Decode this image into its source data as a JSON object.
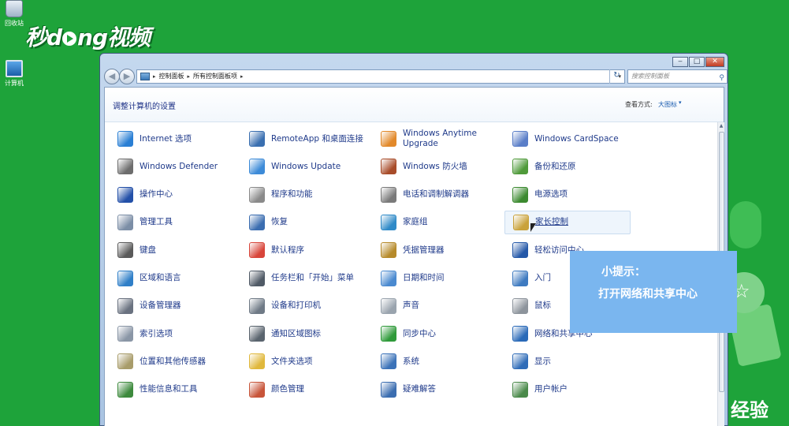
{
  "desktop": {
    "icons": [
      {
        "label": "回收站",
        "icon": "recycle-bin-icon"
      },
      {
        "label": "计算机",
        "icon": "computer-icon"
      }
    ]
  },
  "watermark": {
    "text_left": "秒d",
    "text_right": "ng视频"
  },
  "decoration_text": "经验",
  "window": {
    "controls": {
      "minimize": "‒",
      "maximize": "□",
      "close": "✕"
    },
    "nav": {
      "back": "◀",
      "forward": "▶"
    },
    "address": {
      "crumbs": [
        "控制面板",
        "所有控制面板项"
      ]
    },
    "search": {
      "placeholder": "搜索控制面板"
    },
    "page_title": "调整计算机的设置",
    "view": {
      "label": "查看方式:",
      "value": "大图标"
    },
    "items": [
      [
        {
          "label": "Internet 选项",
          "icon": "globe-icon",
          "color": "#2a7fd4"
        },
        {
          "label": "RemoteApp 和桌面连接",
          "icon": "remote-desktop-icon",
          "color": "#3a6fb0"
        },
        {
          "label": "Windows Anytime Upgrade",
          "icon": "windows-flag-icon",
          "color": "#e2892a"
        },
        {
          "label": "Windows CardSpace",
          "icon": "cardspace-icon",
          "color": "#5a7ec8"
        }
      ],
      [
        {
          "label": "Windows Defender",
          "icon": "defender-icon",
          "color": "#6d6d6d"
        },
        {
          "label": "Windows Update",
          "icon": "update-icon",
          "color": "#3d8bd8"
        },
        {
          "label": "Windows 防火墙",
          "icon": "firewall-icon",
          "color": "#a84c2a"
        },
        {
          "label": "备份和还原",
          "icon": "backup-icon",
          "color": "#4f9a3a"
        }
      ],
      [
        {
          "label": "操作中心",
          "icon": "action-center-flag-icon",
          "color": "#2350a8"
        },
        {
          "label": "程序和功能",
          "icon": "programs-icon",
          "color": "#8a8a8a"
        },
        {
          "label": "电话和调制解调器",
          "icon": "phone-modem-icon",
          "color": "#7a7a7a"
        },
        {
          "label": "电源选项",
          "icon": "power-icon",
          "color": "#3c8a30"
        }
      ],
      [
        {
          "label": "管理工具",
          "icon": "admin-tools-icon",
          "color": "#7c8ea6"
        },
        {
          "label": "恢复",
          "icon": "recovery-icon",
          "color": "#3b6db0"
        },
        {
          "label": "家庭组",
          "icon": "homegroup-icon",
          "color": "#2f8ac8"
        },
        {
          "label": "家长控制",
          "icon": "parental-controls-icon",
          "color": "#c9a23b"
        }
      ],
      [
        {
          "label": "键盘",
          "icon": "keyboard-icon",
          "color": "#5a5a5a"
        },
        {
          "label": "默认程序",
          "icon": "default-programs-icon",
          "color": "#d8453a"
        },
        {
          "label": "凭据管理器",
          "icon": "credential-icon",
          "color": "#b68a2a"
        },
        {
          "label": "轻松访问中心",
          "icon": "ease-of-access-icon",
          "color": "#2458a8"
        }
      ],
      [
        {
          "label": "区域和语言",
          "icon": "region-globe-icon",
          "color": "#2f7fc8"
        },
        {
          "label": "任务栏和「开始」菜单",
          "icon": "taskbar-icon",
          "color": "#505a66"
        },
        {
          "label": "日期和时间",
          "icon": "datetime-icon",
          "color": "#4a8ad0"
        },
        {
          "label": "入门",
          "icon": "getting-started-icon",
          "color": "#3e7ac0"
        }
      ],
      [
        {
          "label": "设备管理器",
          "icon": "device-manager-icon",
          "color": "#6a7280"
        },
        {
          "label": "设备和打印机",
          "icon": "printer-icon",
          "color": "#6f7a86"
        },
        {
          "label": "声音",
          "icon": "sound-icon",
          "color": "#9aa4ae"
        },
        {
          "label": "鼠标",
          "icon": "mouse-icon",
          "color": "#8d949c"
        }
      ],
      [
        {
          "label": "索引选项",
          "icon": "indexing-icon",
          "color": "#8a96a6"
        },
        {
          "label": "通知区域图标",
          "icon": "notification-icon",
          "color": "#5a646e"
        },
        {
          "label": "同步中心",
          "icon": "sync-icon",
          "color": "#2f9a3a"
        },
        {
          "label": "网络和共享中心",
          "icon": "network-icon",
          "color": "#2a6ab8"
        }
      ],
      [
        {
          "label": "位置和其他传感器",
          "icon": "sensor-icon",
          "color": "#a89c6a"
        },
        {
          "label": "文件夹选项",
          "icon": "folder-options-icon",
          "color": "#e0b83c"
        },
        {
          "label": "系统",
          "icon": "system-icon",
          "color": "#3b72b8"
        },
        {
          "label": "显示",
          "icon": "display-icon",
          "color": "#2f6cb8"
        }
      ],
      [
        {
          "label": "性能信息和工具",
          "icon": "performance-icon",
          "color": "#3d8a3d"
        },
        {
          "label": "颜色管理",
          "icon": "color-management-icon",
          "color": "#c8553a"
        },
        {
          "label": "疑难解答",
          "icon": "troubleshoot-icon",
          "color": "#3b6db0"
        },
        {
          "label": "用户帐户",
          "icon": "user-accounts-icon",
          "color": "#4a8a4a"
        }
      ]
    ]
  },
  "tip": {
    "title": "小提示：",
    "body": "打开网络和共享中心"
  },
  "colors": {
    "desktop": "#1ea33a",
    "link": "#1f3a8a",
    "tip": "#7ab6ef"
  }
}
